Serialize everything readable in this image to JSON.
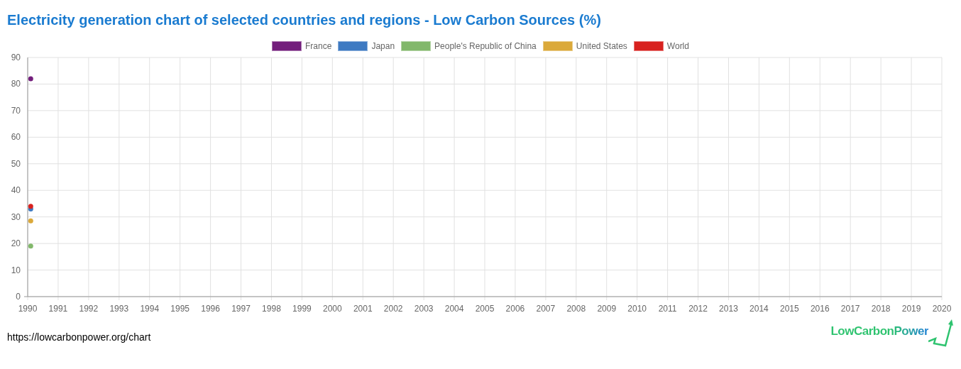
{
  "title": "Electricity generation chart of selected countries and regions - Low Carbon Sources (%)",
  "chart_data": {
    "type": "scatter",
    "grid": true,
    "xlim": [
      1990,
      2020
    ],
    "ylim": [
      0,
      90
    ],
    "xticks": [
      1990,
      1991,
      1992,
      1993,
      1994,
      1995,
      1996,
      1997,
      1998,
      1999,
      2000,
      2001,
      2002,
      2003,
      2004,
      2005,
      2006,
      2007,
      2008,
      2009,
      2010,
      2011,
      2012,
      2013,
      2014,
      2015,
      2016,
      2017,
      2018,
      2019,
      2020
    ],
    "yticks": [
      0,
      10,
      20,
      30,
      40,
      50,
      60,
      70,
      80,
      90
    ],
    "x": [
      1990.1
    ],
    "series": [
      {
        "name": "France",
        "color": "#731e7c",
        "values": [
          82
        ]
      },
      {
        "name": "Japan",
        "color": "#3e7ac2",
        "values": [
          33
        ]
      },
      {
        "name": "People's Republic of China",
        "color": "#82b86b",
        "values": [
          19
        ]
      },
      {
        "name": "United States",
        "color": "#dba93a",
        "values": [
          28.5
        ]
      },
      {
        "name": "World",
        "color": "#d8221f",
        "values": [
          34
        ]
      }
    ]
  },
  "logo": "LowCarbonPower",
  "source_url": "https://lowcarbonpower.org/chart"
}
